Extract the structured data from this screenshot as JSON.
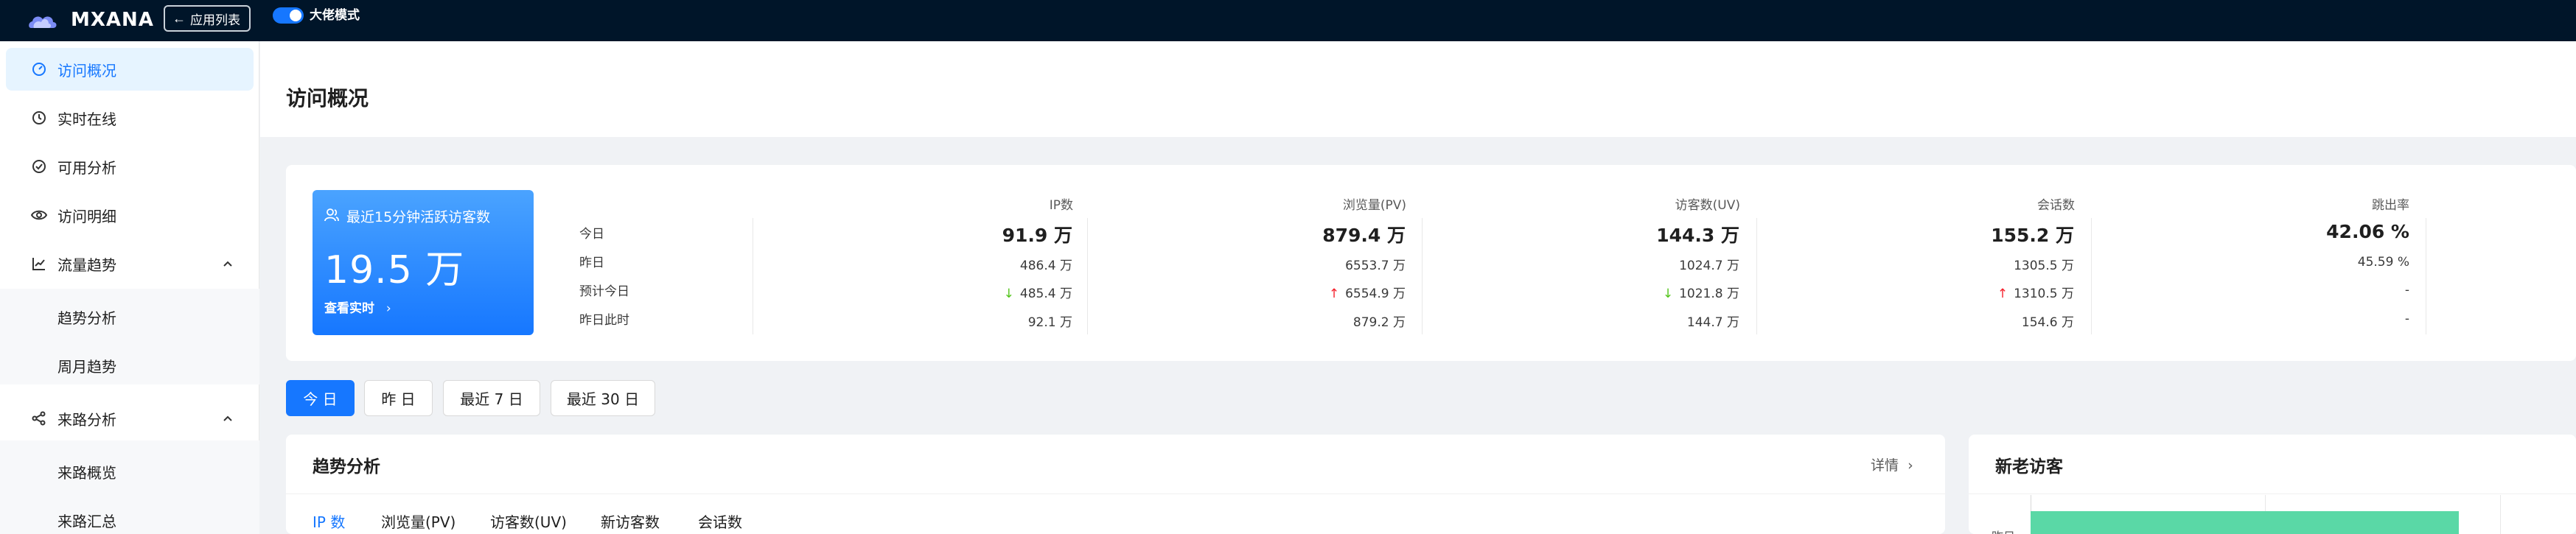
{
  "topbar": {
    "brand": "MXANA",
    "app_list_label": "应用列表",
    "mode_label": "大佬模式",
    "mode_on": true,
    "accent": "#1677ff",
    "bg": "#001529"
  },
  "sidebar": {
    "items": [
      {
        "label": "访问概况",
        "icon": "dashboard-icon",
        "active": true
      },
      {
        "label": "实时在线",
        "icon": "clock-icon"
      },
      {
        "label": "可用分析",
        "icon": "check-circle-icon"
      },
      {
        "label": "访问明细",
        "icon": "eye-icon"
      },
      {
        "label": "流量趋势",
        "icon": "line-chart-icon",
        "expanded": true,
        "children": [
          "趋势分析",
          "周月趋势"
        ]
      },
      {
        "label": "来路分析",
        "icon": "share-icon",
        "expanded": true,
        "children": [
          "来路概览",
          "来路汇总"
        ]
      }
    ]
  },
  "page": {
    "title": "访问概况"
  },
  "live": {
    "title": "最近15分钟活跃访客数",
    "value": "19.5 万",
    "link": "查看实时"
  },
  "stats": {
    "row_labels": [
      "今日",
      "昨日",
      "预计今日",
      "昨日此时"
    ],
    "columns": [
      {
        "header": "IP数",
        "today": "91.9 万",
        "yesterday": "486.4 万",
        "forecast": "485.4 万",
        "forecast_trend": "down",
        "same_time": "92.1 万"
      },
      {
        "header": "浏览量(PV)",
        "today": "879.4 万",
        "yesterday": "6553.7 万",
        "forecast": "6554.9 万",
        "forecast_trend": "up",
        "same_time": "879.2 万"
      },
      {
        "header": "访客数(UV)",
        "today": "144.3 万",
        "yesterday": "1024.7 万",
        "forecast": "1021.8 万",
        "forecast_trend": "down",
        "same_time": "144.7 万"
      },
      {
        "header": "会话数",
        "today": "155.2 万",
        "yesterday": "1305.5 万",
        "forecast": "1310.5 万",
        "forecast_trend": "up",
        "same_time": "154.6 万"
      },
      {
        "header": "跳出率",
        "today": "42.06 %",
        "yesterday": "45.59 %",
        "forecast": "-",
        "forecast_trend": "none",
        "same_time": "-"
      }
    ],
    "up_color": "#f5222d",
    "down_color": "#52c41a"
  },
  "date_tabs": [
    {
      "label": "今 日",
      "active": true
    },
    {
      "label": "昨 日"
    },
    {
      "label": "最近 7 日"
    },
    {
      "label": "最近 30 日"
    }
  ],
  "trend_card": {
    "title": "趋势分析",
    "detail": "详情",
    "tabs": [
      "IP 数",
      "浏览量(PV)",
      "访客数(UV)",
      "新访客数",
      "会话数"
    ],
    "active_tab": 0
  },
  "visitor_card": {
    "title": "新老访客",
    "bar_label": "昨日",
    "bar_color": "#5ad8a6"
  }
}
